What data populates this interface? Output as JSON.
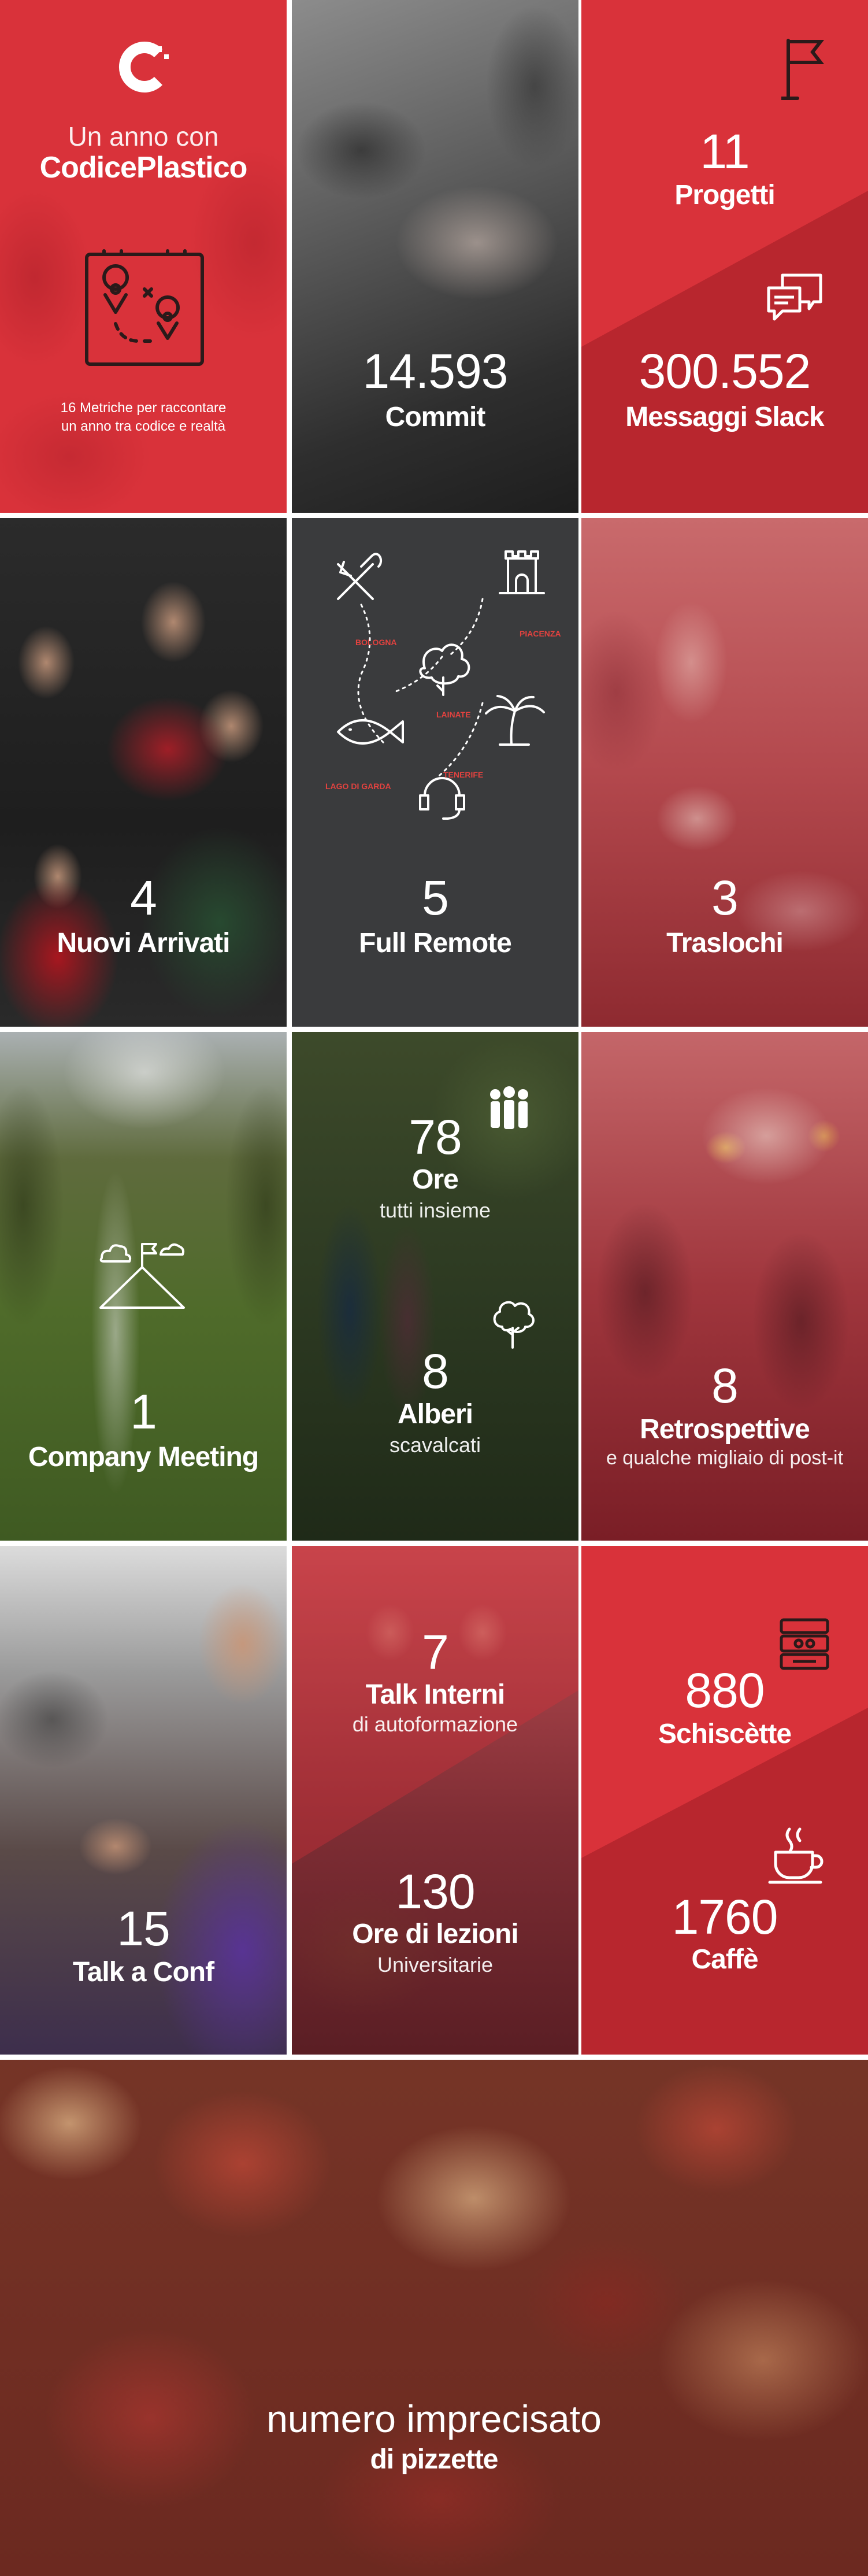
{
  "colors": {
    "red": "#d9323a",
    "dark": "#3a3b3d",
    "white": "#ffffff"
  },
  "intro": {
    "line1": "Un anno con",
    "line2": "CodicePlastico",
    "tagline1": "16 Metriche per raccontare",
    "tagline2": "un anno tra codice e realtà",
    "logo_icon": "c-logo-icon",
    "map_icon": "treasure-map-icon"
  },
  "commit": {
    "value": "14.593",
    "label": "Commit"
  },
  "progetti": {
    "value": "11",
    "label": "Progetti",
    "icon": "flag-icon"
  },
  "slack": {
    "value": "300.552",
    "label": "Messaggi Slack",
    "icon": "chat-bubbles-icon"
  },
  "arrivi": {
    "value": "4",
    "label": "Nuovi Arrivati"
  },
  "remote": {
    "value": "5",
    "label": "Full Remote",
    "places": [
      "BOLOGNA",
      "PIACENZA",
      "LAINATE",
      "LAGO DI GARDA",
      "TENERIFE"
    ]
  },
  "traslochi": {
    "value": "3",
    "label": "Traslochi"
  },
  "meeting": {
    "value": "1",
    "label": "Company Meeting",
    "icon": "mountain-flag-icon"
  },
  "ore": {
    "value": "78",
    "label": "Ore",
    "sub": "tutti insieme",
    "icon": "group-icon"
  },
  "alberi": {
    "value": "8",
    "label": "Alberi",
    "sub": "scavalcati",
    "icon": "tree-icon"
  },
  "retro": {
    "value": "8",
    "label": "Retrospettive",
    "sub": "e qualche migliaio di post-it"
  },
  "talkconf": {
    "value": "15",
    "label": "Talk a Conf"
  },
  "talkint": {
    "value": "7",
    "label": "Talk Interni",
    "sub": "di autoformazione"
  },
  "lezioni": {
    "value": "130",
    "label": "Ore di lezioni",
    "sub": "Universitarie"
  },
  "schiscette": {
    "value": "880",
    "label": "Schiscètte",
    "icon": "lunchbox-icon"
  },
  "caffe": {
    "value": "1760",
    "label": "Caffè",
    "icon": "coffee-cup-icon"
  },
  "pizzette": {
    "value": "numero imprecisato",
    "label": "di pizzette"
  }
}
